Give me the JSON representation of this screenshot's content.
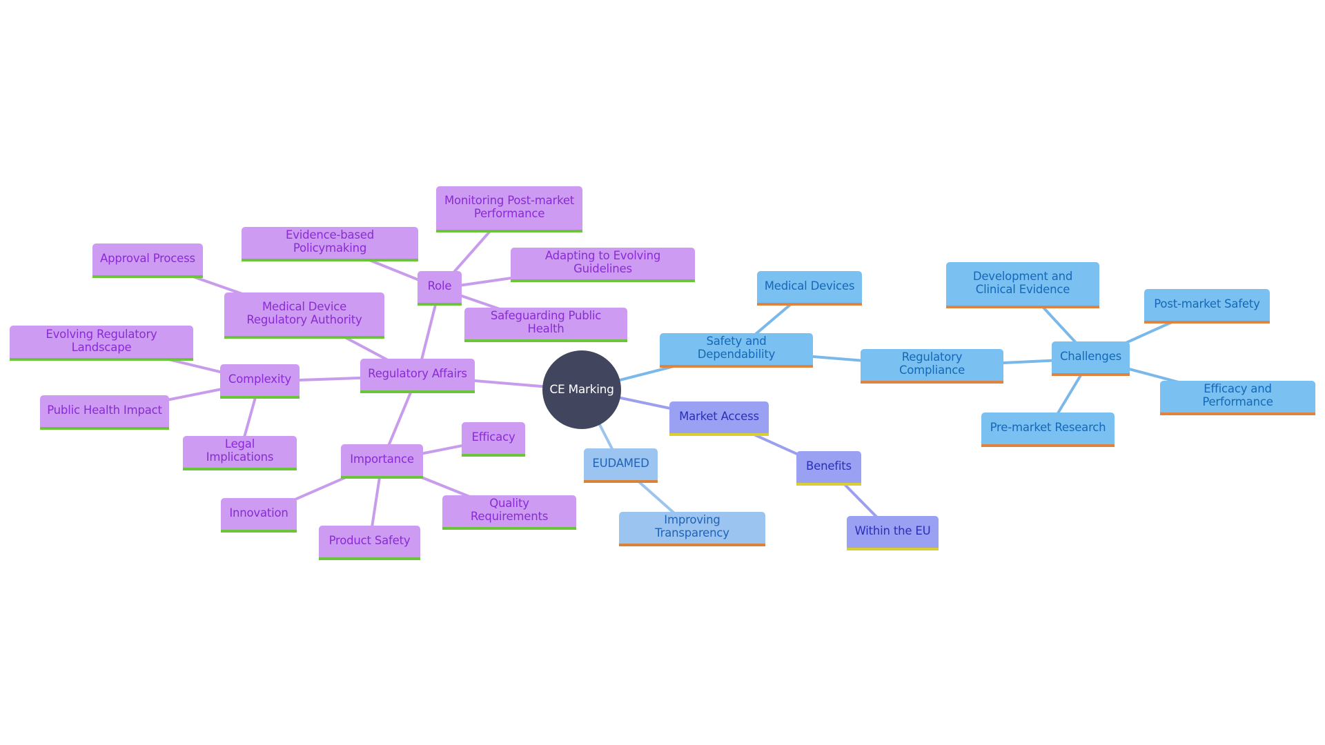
{
  "diagram": {
    "type": "mindmap",
    "root": {
      "id": "ce",
      "label": "CE Marking"
    },
    "colors": {
      "root_fill": "#41455d",
      "purple_branch": {
        "fill": "#cd9cf2",
        "text": "#8a2ad4",
        "underline": "#6cc43a",
        "edge": "#c89cec"
      },
      "blue_branch": {
        "fill": "#7ac0f0",
        "text": "#1568b8",
        "underline": "#e0833e",
        "edge": "#7ab8ea"
      },
      "light_blue_branch": {
        "fill": "#9cc4f0",
        "text": "#1f62b8",
        "underline": "#d9823a",
        "edge": "#9cc4ee"
      },
      "indigo_branch": {
        "fill": "#9aa0f2",
        "text": "#2a2fb8",
        "underline": "#d8cf32",
        "edge": "#9aa0ee"
      }
    },
    "nodes": [
      {
        "id": "ra",
        "label": "Regulatory Affairs",
        "parent": "ce",
        "branch": "purple"
      },
      {
        "id": "role",
        "label": "Role",
        "parent": "ra",
        "branch": "purple"
      },
      {
        "id": "mpm",
        "label": "Monitoring Post-market Performance",
        "parent": "role",
        "branch": "purple"
      },
      {
        "id": "ebp",
        "label": "Evidence-based Policymaking",
        "parent": "role",
        "branch": "purple"
      },
      {
        "id": "aeg",
        "label": "Adapting to Evolving Guidelines",
        "parent": "role",
        "branch": "purple"
      },
      {
        "id": "sph",
        "label": "Safeguarding Public Health",
        "parent": "role",
        "branch": "purple"
      },
      {
        "id": "mdra",
        "label": "Medical Device Regulatory Authority",
        "parent": "ra",
        "branch": "purple"
      },
      {
        "id": "ap",
        "label": "Approval Process",
        "parent": "mdra",
        "branch": "purple"
      },
      {
        "id": "cx",
        "label": "Complexity",
        "parent": "ra",
        "branch": "purple"
      },
      {
        "id": "erl",
        "label": "Evolving Regulatory Landscape",
        "parent": "cx",
        "branch": "purple"
      },
      {
        "id": "phi",
        "label": "Public Health Impact",
        "parent": "cx",
        "branch": "purple"
      },
      {
        "id": "li",
        "label": "Legal Implications",
        "parent": "cx",
        "branch": "purple"
      },
      {
        "id": "imp",
        "label": "Importance",
        "parent": "ra",
        "branch": "purple"
      },
      {
        "id": "eff",
        "label": "Efficacy",
        "parent": "imp",
        "branch": "purple"
      },
      {
        "id": "qr",
        "label": "Quality Requirements",
        "parent": "imp",
        "branch": "purple"
      },
      {
        "id": "ps",
        "label": "Product Safety",
        "parent": "imp",
        "branch": "purple"
      },
      {
        "id": "inn",
        "label": "Innovation",
        "parent": "imp",
        "branch": "purple"
      },
      {
        "id": "sd",
        "label": "Safety and Dependability",
        "parent": "ce",
        "branch": "blue"
      },
      {
        "id": "md",
        "label": "Medical Devices",
        "parent": "sd",
        "branch": "blue"
      },
      {
        "id": "rc",
        "label": "Regulatory Compliance",
        "parent": "sd",
        "branch": "blue"
      },
      {
        "id": "ch",
        "label": "Challenges",
        "parent": "rc",
        "branch": "blue"
      },
      {
        "id": "dce",
        "label": "Development and Clinical Evidence",
        "parent": "ch",
        "branch": "blue"
      },
      {
        "id": "pms",
        "label": "Post-market Safety",
        "parent": "ch",
        "branch": "blue"
      },
      {
        "id": "ep",
        "label": "Efficacy and Performance",
        "parent": "ch",
        "branch": "blue"
      },
      {
        "id": "pmr",
        "label": "Pre-market Research",
        "parent": "ch",
        "branch": "blue"
      },
      {
        "id": "ma",
        "label": "Market Access",
        "parent": "ce",
        "branch": "indigo"
      },
      {
        "id": "ben",
        "label": "Benefits",
        "parent": "ma",
        "branch": "indigo"
      },
      {
        "id": "weu",
        "label": "Within the EU",
        "parent": "ben",
        "branch": "indigo"
      },
      {
        "id": "eud",
        "label": "EUDAMED",
        "parent": "ce",
        "branch": "light_blue"
      },
      {
        "id": "it",
        "label": "Improving Transparency",
        "parent": "eud",
        "branch": "light_blue"
      }
    ]
  }
}
